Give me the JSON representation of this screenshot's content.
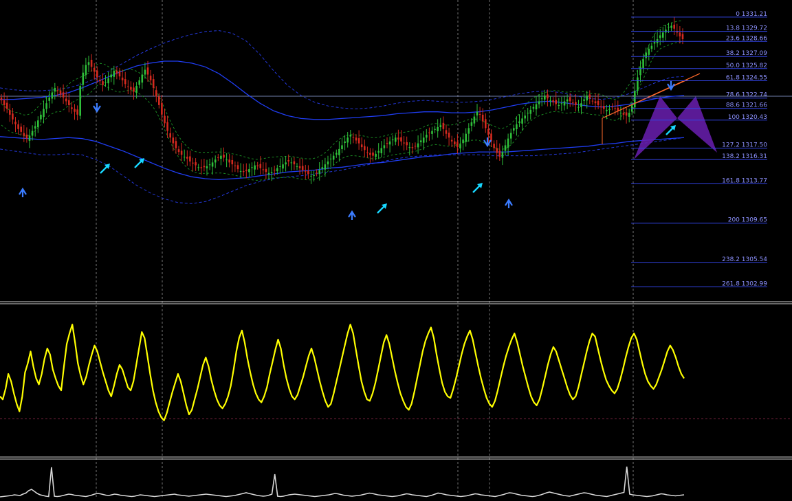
{
  "colors": {
    "background": "#000000",
    "candle_up": "#2fbf3a",
    "candle_down": "#d42a1f",
    "band_solid": "#1f3df2",
    "band_dash": "#2337d8",
    "inner_band_dash": "#1a8a22",
    "fib_line": "#3344e6",
    "fib_label": "#8d92ff",
    "oscillator": "#ffff00",
    "oscillator_ref": "#7a2440",
    "lower_indicator": "#d8d8d8",
    "arrow_signal": "#17d7ff",
    "fractal_marker": "#3b7cff",
    "trend_line": "#ff6a2a",
    "harmonic_pattern": "#6a1fb0",
    "grid": "#9a9a9a",
    "separator": "#d0d0d0"
  },
  "fib_levels": [
    {
      "text": "0 1331.21",
      "level": 0,
      "price": 1331.21
    },
    {
      "text": "13.8 1329.72",
      "level": 13.8,
      "price": 1329.72
    },
    {
      "text": "23.6 1328.66",
      "level": 23.6,
      "price": 1328.66
    },
    {
      "text": "38.2 1327.09",
      "level": 38.2,
      "price": 1327.09
    },
    {
      "text": "50.0 1325.82",
      "level": 50.0,
      "price": 1325.82
    },
    {
      "text": "61.8 1324.55",
      "level": 61.8,
      "price": 1324.55
    },
    {
      "text": "78.6 1322.74",
      "level": 78.6,
      "price": 1322.74
    },
    {
      "text": "88.6 1321.66",
      "level": 88.6,
      "price": 1321.66
    },
    {
      "text": "100 1320.43",
      "level": 100,
      "price": 1320.43
    },
    {
      "text": "127.2 1317.50",
      "level": 127.2,
      "price": 1317.5
    },
    {
      "text": "138.2 1316.31",
      "level": 138.2,
      "price": 1316.31
    },
    {
      "text": "161.8 1313.77",
      "level": 161.8,
      "price": 1313.77
    },
    {
      "text": "200 1309.65",
      "level": 200,
      "price": 1309.65
    },
    {
      "text": "238.2 1305.54",
      "level": 238.2,
      "price": 1305.54
    },
    {
      "text": "261.8 1302.99",
      "level": 261.8,
      "price": 1302.99
    }
  ],
  "chart_data": [
    {
      "type": "candlestick",
      "panel": "price",
      "title": "",
      "xlabel": "",
      "ylabel": "",
      "ylim": [
        1301.5,
        1333.0
      ],
      "bar_count": 240,
      "grid": "vertical dashed separators",
      "series": [
        {
          "kind": "close",
          "values": [
            1322.5,
            1322.0,
            1321.6,
            1321.0,
            1320.5,
            1320.0,
            1319.5,
            1319.2,
            1318.8,
            1318.5,
            1318.8,
            1319.3,
            1319.8,
            1320.4,
            1321.0,
            1321.6,
            1322.2,
            1322.8,
            1323.3,
            1323.8,
            1323.5,
            1323.1,
            1322.8,
            1322.4,
            1322.0,
            1321.6,
            1321.3,
            1321.0,
            1324.0,
            1325.4,
            1326.2,
            1326.5,
            1326.0,
            1325.5,
            1324.9,
            1324.5,
            1324.1,
            1324.4,
            1324.8,
            1325.2,
            1325.6,
            1325.3,
            1325.0,
            1324.6,
            1324.2,
            1323.9,
            1323.6,
            1323.4,
            1324.0,
            1324.6,
            1325.2,
            1325.7,
            1325.2,
            1324.6,
            1323.8,
            1322.9,
            1322.0,
            1321.0,
            1320.1,
            1319.3,
            1318.6,
            1318.0,
            1317.5,
            1317.1,
            1316.8,
            1316.6,
            1316.4,
            1316.1,
            1315.9,
            1315.7,
            1315.5,
            1315.4,
            1315.5,
            1315.6,
            1315.8,
            1316.0,
            1316.3,
            1316.5,
            1316.7,
            1316.5,
            1316.3,
            1316.0,
            1315.8,
            1315.6,
            1315.3,
            1315.1,
            1315.0,
            1315.1,
            1315.3,
            1315.5,
            1315.7,
            1315.6,
            1315.4,
            1315.2,
            1315.0,
            1314.9,
            1315.0,
            1315.2,
            1315.4,
            1315.6,
            1315.8,
            1316.0,
            1316.1,
            1316.0,
            1315.8,
            1315.6,
            1315.4,
            1315.2,
            1315.0,
            1314.8,
            1314.6,
            1314.7,
            1314.9,
            1315.2,
            1315.5,
            1315.8,
            1316.1,
            1316.4,
            1316.7,
            1317.0,
            1317.4,
            1317.8,
            1318.2,
            1318.6,
            1318.9,
            1318.6,
            1318.3,
            1318.0,
            1317.6,
            1317.3,
            1317.0,
            1316.8,
            1316.7,
            1316.9,
            1317.2,
            1317.5,
            1317.8,
            1318.0,
            1318.2,
            1318.4,
            1318.6,
            1318.4,
            1318.2,
            1318.0,
            1317.8,
            1317.6,
            1317.5,
            1317.7,
            1318.0,
            1318.3,
            1318.6,
            1318.9,
            1319.1,
            1319.3,
            1319.5,
            1319.7,
            1319.9,
            1319.5,
            1319.0,
            1318.6,
            1318.2,
            1317.9,
            1317.6,
            1317.9,
            1318.4,
            1319.0,
            1319.6,
            1320.2,
            1320.8,
            1321.3,
            1321.0,
            1320.3,
            1319.6,
            1318.9,
            1318.2,
            1317.5,
            1317.0,
            1316.6,
            1317.1,
            1317.8,
            1318.5,
            1319.1,
            1319.6,
            1320.0,
            1320.3,
            1320.6,
            1320.9,
            1321.2,
            1321.5,
            1321.8,
            1322.1,
            1322.4,
            1322.7,
            1323.0,
            1322.7,
            1322.5,
            1322.3,
            1322.1,
            1322.0,
            1322.2,
            1322.4,
            1322.6,
            1322.4,
            1322.2,
            1322.0,
            1321.8,
            1322.2,
            1322.6,
            1323.0,
            1322.7,
            1322.4,
            1322.2,
            1322.0,
            1321.8,
            1321.6,
            1321.5,
            1321.6,
            1321.8,
            1321.6,
            1321.4,
            1321.2,
            1321.0,
            1320.9,
            1321.2,
            1322.0,
            1323.5,
            1324.9,
            1326.0,
            1326.8,
            1327.5,
            1327.9,
            1328.2,
            1328.6,
            1328.9,
            1329.3,
            1329.6,
            1329.9,
            1330.2,
            1330.3,
            1330.0,
            1329.6,
            1329.2,
            1328.9
          ]
        },
        {
          "kind": "upper_band_outer",
          "values": [
            1323.8,
            1323.6,
            1323.5,
            1323.5,
            1323.6,
            1323.8,
            1324.2,
            1324.8,
            1325.6,
            1326.4,
            1327.2,
            1327.9,
            1328.5,
            1329.0,
            1329.4,
            1329.7,
            1329.8,
            1329.5,
            1328.7,
            1327.3,
            1325.6,
            1324.1,
            1323.0,
            1322.3,
            1321.9,
            1321.7,
            1321.6,
            1321.7,
            1321.9,
            1322.2,
            1322.4,
            1322.5,
            1322.4,
            1322.3,
            1322.3,
            1322.4,
            1322.6,
            1322.9,
            1323.2,
            1323.4,
            1323.5,
            1323.3,
            1323.0,
            1322.7,
            1322.6,
            1322.8,
            1323.2,
            1323.8,
            1324.4,
            1324.9,
            1325.0
          ]
        },
        {
          "kind": "upper_band_solid",
          "values": [
            1322.6,
            1322.6,
            1322.7,
            1322.8,
            1323.0,
            1323.3,
            1323.8,
            1324.4,
            1325.0,
            1325.6,
            1326.1,
            1326.4,
            1326.6,
            1326.6,
            1326.4,
            1326.0,
            1325.3,
            1324.3,
            1323.2,
            1322.2,
            1321.4,
            1320.9,
            1320.6,
            1320.5,
            1320.5,
            1320.6,
            1320.7,
            1320.8,
            1320.9,
            1321.1,
            1321.2,
            1321.3,
            1321.3,
            1321.2,
            1321.2,
            1321.3,
            1321.5,
            1321.8,
            1322.1,
            1322.3,
            1322.4,
            1322.3,
            1322.1,
            1321.9,
            1321.8,
            1321.9,
            1322.1,
            1322.4,
            1322.7,
            1322.9,
            1323.0
          ]
        },
        {
          "kind": "lower_band_solid",
          "values": [
            1318.7,
            1318.6,
            1318.5,
            1318.4,
            1318.5,
            1318.6,
            1318.5,
            1318.2,
            1317.7,
            1317.2,
            1316.6,
            1316.0,
            1315.4,
            1314.9,
            1314.5,
            1314.3,
            1314.2,
            1314.3,
            1314.4,
            1314.6,
            1314.8,
            1315.0,
            1315.1,
            1315.2,
            1315.4,
            1315.5,
            1315.7,
            1315.9,
            1316.0,
            1316.2,
            1316.4,
            1316.6,
            1316.7,
            1316.9,
            1317.0,
            1317.1,
            1317.1,
            1317.1,
            1317.2,
            1317.3,
            1317.4,
            1317.5,
            1317.6,
            1317.7,
            1317.9,
            1318.0,
            1318.2,
            1318.3,
            1318.4,
            1318.5,
            1318.6
          ]
        },
        {
          "kind": "lower_band_outer",
          "values": [
            1317.4,
            1317.2,
            1317.0,
            1316.8,
            1316.8,
            1316.9,
            1316.8,
            1316.3,
            1315.6,
            1314.6,
            1313.6,
            1312.8,
            1312.2,
            1311.8,
            1311.7,
            1311.9,
            1312.4,
            1313.0,
            1313.6,
            1314.0,
            1314.3,
            1314.5,
            1314.6,
            1314.8,
            1315.0,
            1315.2,
            1315.5,
            1315.8,
            1316.1,
            1316.4,
            1316.6,
            1316.7,
            1316.8,
            1316.8,
            1316.8,
            1316.8,
            1316.7,
            1316.7,
            1316.7,
            1316.7,
            1316.8,
            1316.9,
            1317.0,
            1317.2,
            1317.4,
            1317.6,
            1317.8,
            1318.0,
            1318.2,
            1318.4,
            1318.6
          ]
        }
      ]
    },
    {
      "type": "line",
      "panel": "oscillator",
      "title": "",
      "xlabel": "",
      "ylabel": "",
      "ylim": [
        0,
        100
      ],
      "reference_line": 25,
      "series": [
        {
          "values": [
            40,
            38,
            45,
            55,
            50,
            42,
            35,
            30,
            40,
            56,
            62,
            70,
            60,
            52,
            48,
            55,
            65,
            72,
            68,
            58,
            52,
            47,
            44,
            60,
            75,
            82,
            88,
            76,
            62,
            54,
            48,
            53,
            61,
            68,
            74,
            70,
            63,
            56,
            50,
            44,
            40,
            47,
            55,
            61,
            58,
            52,
            46,
            44,
            50,
            61,
            72,
            83,
            79,
            67,
            55,
            44,
            36,
            30,
            26,
            24,
            29,
            36,
            43,
            49,
            55,
            50,
            42,
            34,
            28,
            31,
            38,
            45,
            53,
            61,
            66,
            60,
            51,
            44,
            38,
            34,
            32,
            35,
            40,
            47,
            58,
            70,
            79,
            84,
            76,
            65,
            56,
            48,
            42,
            38,
            36,
            40,
            46,
            55,
            63,
            71,
            78,
            72,
            61,
            52,
            45,
            40,
            38,
            41,
            47,
            53,
            60,
            67,
            72,
            66,
            58,
            50,
            43,
            37,
            33,
            35,
            42,
            50,
            58,
            66,
            74,
            82,
            88,
            82,
            71,
            60,
            50,
            43,
            38,
            37,
            42,
            49,
            58,
            67,
            76,
            81,
            75,
            66,
            57,
            49,
            42,
            37,
            33,
            31,
            35,
            43,
            52,
            61,
            70,
            77,
            82,
            86,
            79,
            68,
            58,
            49,
            43,
            40,
            39,
            45,
            52,
            60,
            68,
            75,
            80,
            84,
            78,
            69,
            60,
            52,
            45,
            39,
            35,
            33,
            37,
            44,
            52,
            60,
            67,
            73,
            78,
            82,
            76,
            68,
            60,
            53,
            46,
            40,
            36,
            34,
            38,
            45,
            53,
            61,
            68,
            73,
            70,
            64,
            58,
            52,
            46,
            41,
            38,
            40,
            46,
            54,
            62,
            70,
            77,
            82,
            80,
            72,
            64,
            57,
            51,
            47,
            44,
            42,
            45,
            51,
            58,
            66,
            73,
            79,
            82,
            78,
            70,
            62,
            55,
            50,
            47,
            45,
            48,
            53,
            58,
            64,
            70,
            74,
            71,
            66,
            60,
            55,
            52
          ]
        }
      ]
    },
    {
      "type": "line",
      "panel": "lower_indicator",
      "title": "",
      "xlabel": "",
      "ylabel": "",
      "ylim": [
        0,
        100
      ],
      "series": [
        {
          "values": [
            4,
            5,
            6,
            7,
            8,
            10,
            9,
            8,
            12,
            15,
            22,
            26,
            20,
            14,
            10,
            8,
            6,
            5,
            90,
            6,
            5,
            6,
            8,
            10,
            12,
            11,
            9,
            8,
            7,
            6,
            5,
            7,
            9,
            12,
            14,
            13,
            11,
            9,
            8,
            10,
            12,
            11,
            9,
            8,
            7,
            6,
            5,
            6,
            8,
            10,
            9,
            8,
            7,
            6,
            5,
            6,
            7,
            8,
            9,
            10,
            11,
            12,
            10,
            9,
            8,
            7,
            6,
            7,
            8,
            9,
            10,
            11,
            12,
            11,
            10,
            9,
            8,
            7,
            6,
            5,
            6,
            7,
            8,
            10,
            12,
            14,
            16,
            14,
            12,
            10,
            8,
            7,
            6,
            7,
            9,
            12,
            70,
            6,
            5,
            6,
            8,
            10,
            11,
            12,
            11,
            10,
            9,
            8,
            7,
            6,
            5,
            6,
            7,
            8,
            9,
            10,
            12,
            14,
            13,
            11,
            9,
            8,
            7,
            6,
            7,
            8,
            9,
            11,
            13,
            15,
            14,
            12,
            10,
            9,
            8,
            7,
            6,
            5,
            6,
            7,
            9,
            11,
            13,
            12,
            10,
            9,
            8,
            7,
            6,
            5,
            7,
            9,
            12,
            15,
            14,
            12,
            10,
            9,
            8,
            7,
            6,
            5,
            6,
            7,
            9,
            11,
            13,
            12,
            10,
            9,
            8,
            7,
            6,
            5,
            7,
            9,
            11,
            14,
            16,
            15,
            13,
            11,
            9,
            8,
            7,
            6,
            5,
            6,
            8,
            10,
            13,
            16,
            18,
            16,
            14,
            12,
            10,
            8,
            7,
            6,
            8,
            10,
            12,
            14,
            16,
            15,
            13,
            11,
            9,
            8,
            7,
            6,
            5,
            7,
            9,
            11,
            13,
            15,
            17,
            92,
            12,
            10,
            9,
            8,
            7,
            6,
            5,
            6,
            7,
            9,
            11,
            13,
            12,
            10,
            9,
            8,
            7,
            8,
            9,
            10
          ]
        }
      ]
    }
  ]
}
